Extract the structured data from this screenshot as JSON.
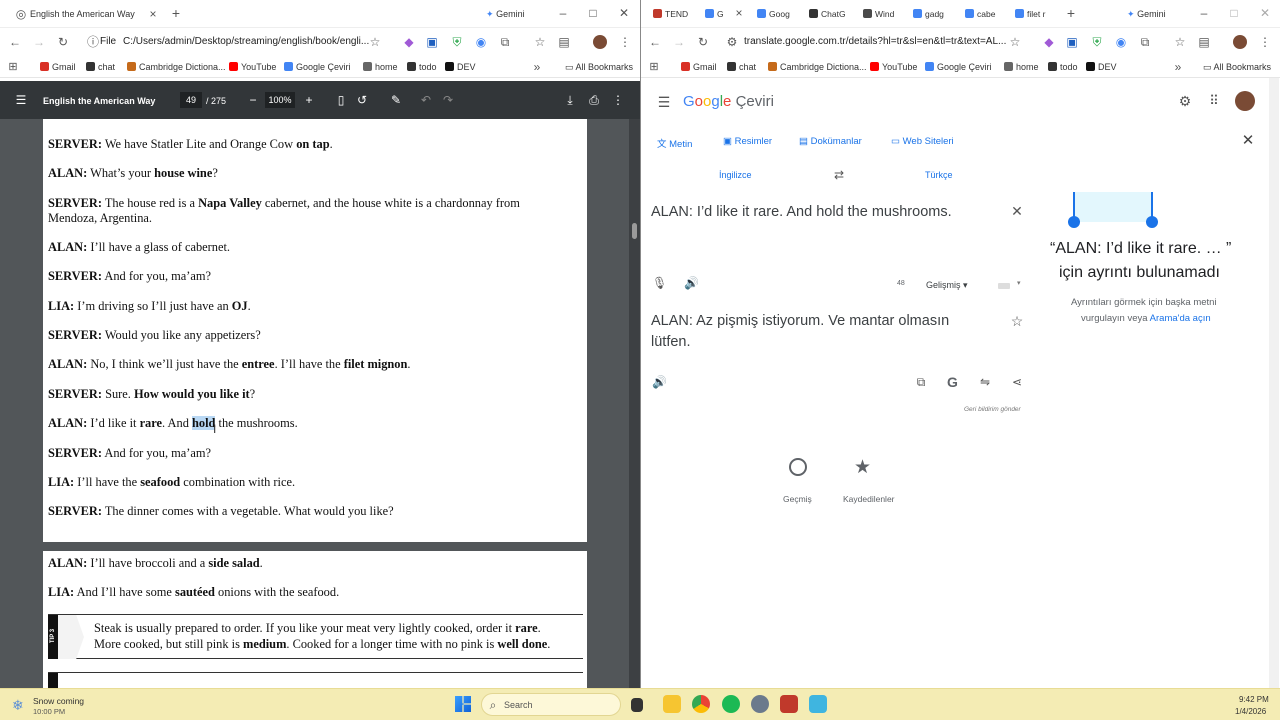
{
  "left_window": {
    "tab_title": "English the American Way",
    "tab_new": "+",
    "gemini_label": "Gemini",
    "url_prefix": "File",
    "url": "C:/Users/admin/Desktop/streaming/english/book/engli...",
    "bookmarks": [
      {
        "label": "Gmail",
        "color": "#d93025"
      },
      {
        "label": "chat",
        "color": "#333333"
      },
      {
        "label": "Cambridge Dictiona...",
        "color": "#c56a1a"
      },
      {
        "label": "YouTube",
        "color": "#ff0000"
      },
      {
        "label": "Google Çeviri",
        "color": "#4285f4"
      },
      {
        "label": "home",
        "color": "#666666"
      },
      {
        "label": "todo",
        "color": "#333333"
      },
      {
        "label": "DEV",
        "color": "#111111"
      }
    ],
    "all_bookmarks": "All Bookmarks",
    "pdf": {
      "title": "English the American Way",
      "page_current": "49",
      "page_total": "/ 275",
      "zoom": "100%",
      "page1_lines": [
        {
          "segments": [
            {
              "t": "SERVER:",
              "b": true
            },
            {
              "t": " We have Statler Lite and Orange Cow "
            },
            {
              "t": "on tap",
              "b": true
            },
            {
              "t": "."
            }
          ]
        },
        {
          "segments": [
            {
              "t": "ALAN:",
              "b": true
            },
            {
              "t": " What’s your "
            },
            {
              "t": "house wine",
              "b": true
            },
            {
              "t": "?"
            }
          ]
        },
        {
          "segments": [
            {
              "t": "SERVER:",
              "b": true
            },
            {
              "t": " The house red is a "
            },
            {
              "t": "Napa Valley",
              "b": true
            },
            {
              "t": " cabernet, and the house white is a chardonnay from"
            }
          ]
        },
        {
          "segments": [
            {
              "t": "Mendoza, Argentina."
            }
          ]
        },
        {
          "segments": [
            {
              "t": "ALAN:",
              "b": true
            },
            {
              "t": " I’ll have a glass of cabernet."
            }
          ]
        },
        {
          "segments": [
            {
              "t": "SERVER:",
              "b": true
            },
            {
              "t": " And for you, ma’am?"
            }
          ]
        },
        {
          "segments": [
            {
              "t": "LIA:",
              "b": true
            },
            {
              "t": " I’m driving so I’ll just have an "
            },
            {
              "t": "OJ",
              "b": true
            },
            {
              "t": "."
            }
          ]
        },
        {
          "segments": [
            {
              "t": "SERVER:",
              "b": true
            },
            {
              "t": " Would you like any appetizers?"
            }
          ]
        },
        {
          "segments": [
            {
              "t": "ALAN:",
              "b": true
            },
            {
              "t": " No, I think we’ll just have the "
            },
            {
              "t": "entree",
              "b": true
            },
            {
              "t": ". I’ll have the "
            },
            {
              "t": "filet mignon",
              "b": true
            },
            {
              "t": "."
            }
          ]
        },
        {
          "segments": [
            {
              "t": "SERVER:",
              "b": true
            },
            {
              "t": " Sure. "
            },
            {
              "t": "How would you like it",
              "b": true
            },
            {
              "t": "?"
            }
          ]
        },
        {
          "segments": [
            {
              "t": "ALAN:",
              "b": true
            },
            {
              "t": " I’d like it "
            },
            {
              "t": "rare",
              "b": true
            },
            {
              "t": ". And "
            },
            {
              "t": "hold",
              "b": true,
              "sel": true
            },
            {
              "t": " the mushrooms."
            }
          ]
        },
        {
          "segments": [
            {
              "t": "SERVER:",
              "b": true
            },
            {
              "t": " And for you, ma’am?"
            }
          ]
        },
        {
          "segments": [
            {
              "t": "LIA:",
              "b": true
            },
            {
              "t": " I’ll have the "
            },
            {
              "t": "seafood",
              "b": true
            },
            {
              "t": " combination with rice."
            }
          ]
        },
        {
          "segments": [
            {
              "t": "SERVER:",
              "b": true
            },
            {
              "t": " The dinner comes with a vegetable. What would you like?"
            }
          ]
        }
      ],
      "page2_lines": [
        {
          "segments": [
            {
              "t": "ALAN:",
              "b": true
            },
            {
              "t": " I’ll have broccoli and a "
            },
            {
              "t": "side salad",
              "b": true
            },
            {
              "t": "."
            }
          ]
        },
        {
          "segments": [
            {
              "t": "LIA:",
              "b": true
            },
            {
              "t": " And I’ll have some "
            },
            {
              "t": "sautéed",
              "b": true
            },
            {
              "t": " onions with the seafood."
            }
          ]
        }
      ],
      "tip_label": "TIP 3",
      "tip_lines": [
        {
          "segments": [
            {
              "t": "Steak is usually prepared to order. If you like your meat very lightly cooked, order it "
            },
            {
              "t": "rare",
              "b": true
            },
            {
              "t": "."
            }
          ]
        },
        {
          "segments": [
            {
              "t": "More cooked, but still pink is "
            },
            {
              "t": "medium",
              "b": true
            },
            {
              "t": ". Cooked for a longer time with no pink is "
            },
            {
              "t": "well done",
              "b": true
            },
            {
              "t": "."
            }
          ]
        }
      ]
    }
  },
  "right_window": {
    "tabs": [
      {
        "label": "TEND",
        "color": "#c0392b"
      },
      {
        "label": "G",
        "color": "#4285f4"
      },
      {
        "label": "Goog",
        "color": "#4285f4"
      },
      {
        "label": "ChatG",
        "color": "#333333"
      },
      {
        "label": "Wind",
        "color": "#4a4a4a"
      },
      {
        "label": "gadg",
        "color": "#4285f4"
      },
      {
        "label": "cabe",
        "color": "#4285f4"
      },
      {
        "label": "filet r",
        "color": "#4285f4"
      }
    ],
    "tab_new": "+",
    "gemini_label": "Gemini",
    "url": "translate.google.com.tr/details?hl=tr&sl=en&tl=tr&text=AL...",
    "bookmarks": [
      {
        "label": "Gmail",
        "color": "#d93025"
      },
      {
        "label": "chat",
        "color": "#333333"
      },
      {
        "label": "Cambridge Dictiona...",
        "color": "#c56a1a"
      },
      {
        "label": "YouTube",
        "color": "#ff0000"
      },
      {
        "label": "Google Çeviri",
        "color": "#4285f4"
      },
      {
        "label": "home",
        "color": "#666666"
      },
      {
        "label": "todo",
        "color": "#333333"
      },
      {
        "label": "DEV",
        "color": "#111111"
      }
    ],
    "all_bookmarks": "All Bookmarks",
    "translate": {
      "logo_letters": [
        {
          "c": "G",
          "color": "#4285f4"
        },
        {
          "c": "o",
          "color": "#ea4335"
        },
        {
          "c": "o",
          "color": "#fbbc05"
        },
        {
          "c": "g",
          "color": "#4285f4"
        },
        {
          "c": "l",
          "color": "#34a853"
        },
        {
          "c": "e",
          "color": "#ea4335"
        }
      ],
      "logo_suffix": "Çeviri",
      "modes": [
        "Metin",
        "Resimler",
        "Dokümanlar",
        "Web Siteleri"
      ],
      "source_lang": "İngilizce",
      "target_lang": "Türkçe",
      "source_text": "ALAN: I’d like it rare. And hold the mushrooms.",
      "char_count": "48",
      "mode_select": "Gelişmiş",
      "target_text_line1": "ALAN: Az pişmiş istiyorum. Ve mantar olmasın",
      "target_text_line2": "lütfen.",
      "feedback": "Geri bildirim gönder",
      "history": "Geçmiş",
      "saved": "Kaydedilenler",
      "detail_quote": "“ALAN: I’d like it rare. …  ”",
      "detail_title": "için ayrıntı bulunamadı",
      "detail_hint_line1": "Ayrıntıları görmek için başka metni",
      "detail_hint_prefix": "vurgulayın veya",
      "detail_hint_link": "Arama'da açın"
    }
  },
  "taskbar": {
    "weather_title": "Snow coming",
    "weather_time": "10:00 PM",
    "search": "Search",
    "time": "9:42 PM",
    "date": "1/4/2026"
  }
}
